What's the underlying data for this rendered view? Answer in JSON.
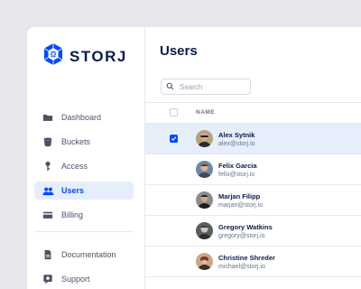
{
  "brand": {
    "name": "STORJ",
    "color": "#0149ff"
  },
  "sidebar": {
    "items": [
      {
        "label": "Dashboard",
        "icon": "folder-icon"
      },
      {
        "label": "Buckets",
        "icon": "bucket-icon"
      },
      {
        "label": "Access",
        "icon": "key-icon"
      },
      {
        "label": "Users",
        "icon": "users-icon",
        "active": true
      },
      {
        "label": "Billing",
        "icon": "credit-card-icon"
      },
      {
        "label": "Documentation",
        "icon": "document-icon"
      },
      {
        "label": "Support",
        "icon": "support-icon"
      }
    ]
  },
  "main": {
    "title": "Users",
    "search": {
      "placeholder": "Search",
      "value": ""
    },
    "table": {
      "columns": [
        "NAME"
      ],
      "rows": [
        {
          "name": "Alex Sytnik",
          "email": "alex@storj.io",
          "selected": true
        },
        {
          "name": "Felix Garcia",
          "email": "felix@storj.io",
          "selected": false
        },
        {
          "name": "Marjan Filipp",
          "email": "marjan@storj.io",
          "selected": false
        },
        {
          "name": "Gregory Watkins",
          "email": "gregory@storj.io",
          "selected": false
        },
        {
          "name": "Christine Shreder",
          "email": "michael@storj.io",
          "selected": false
        }
      ]
    }
  },
  "colors": {
    "background": "#e6e8ee",
    "accent": "#0149ff",
    "selected_row": "#e6eefc",
    "text_dark": "#0b1b4a",
    "text_muted": "#6b7486"
  }
}
